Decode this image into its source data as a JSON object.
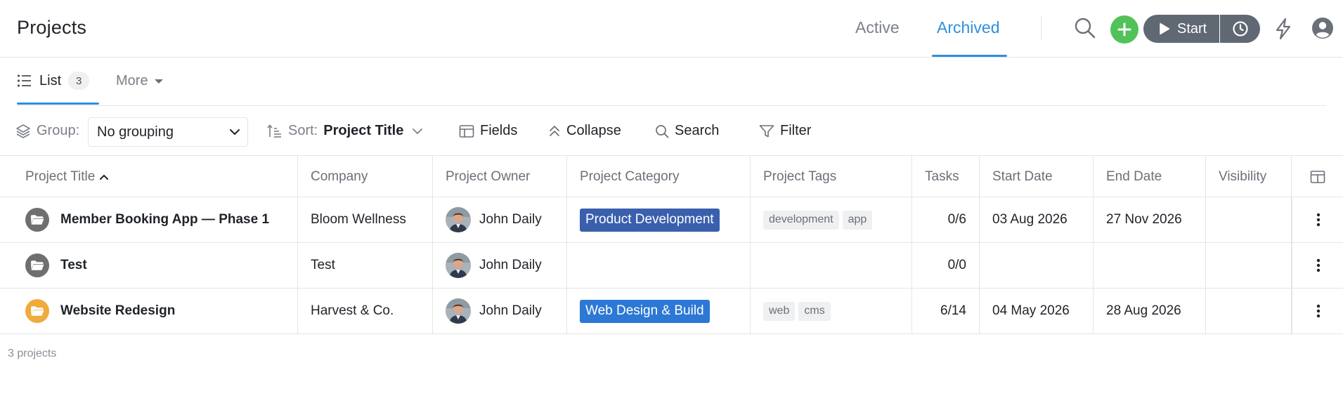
{
  "header": {
    "title": "Projects",
    "tabs": [
      {
        "label": "Active",
        "active": false
      },
      {
        "label": "Archived",
        "active": true
      }
    ],
    "start_label": "Start",
    "colors": {
      "accent": "#2f8fdb",
      "add": "#52c15a",
      "start": "#5f6873"
    }
  },
  "subtabs": {
    "list_label": "List",
    "list_count": "3",
    "more_label": "More"
  },
  "toolbar": {
    "group_label": "Group:",
    "group_value": "No grouping",
    "sort_label": "Sort:",
    "sort_value": "Project Title",
    "fields_label": "Fields",
    "collapse_label": "Collapse",
    "search_label": "Search",
    "filter_label": "Filter"
  },
  "table": {
    "columns": [
      "Project Title",
      "Company",
      "Project Owner",
      "Project Category",
      "Project Tags",
      "Tasks",
      "Start Date",
      "End Date",
      "Visibility"
    ],
    "rows": [
      {
        "title": "Member Booking App — Phase 1",
        "folder_color": "#6f6f6f",
        "company": "Bloom Wellness",
        "owner": "John Daily",
        "category": "Product Development",
        "category_color": "#3a5fad",
        "tags": [
          "development",
          "app"
        ],
        "tasks": "0/6",
        "start": "03 Aug 2026",
        "end": "27 Nov 2026",
        "visibility": ""
      },
      {
        "title": "Test",
        "folder_color": "#6f6f6f",
        "company": "Test",
        "owner": "John Daily",
        "category": "",
        "category_color": "",
        "tags": [],
        "tasks": "0/0",
        "start": "",
        "end": "",
        "visibility": ""
      },
      {
        "title": "Website Redesign",
        "folder_color": "#f0ab3c",
        "company": "Harvest & Co.",
        "owner": "John Daily",
        "category": "Web Design & Build",
        "category_color": "#2c78d4",
        "tags": [
          "web",
          "cms"
        ],
        "tasks": "6/14",
        "start": "04 May 2026",
        "end": "28 Aug 2026",
        "visibility": ""
      }
    ],
    "footer": "3 projects"
  }
}
